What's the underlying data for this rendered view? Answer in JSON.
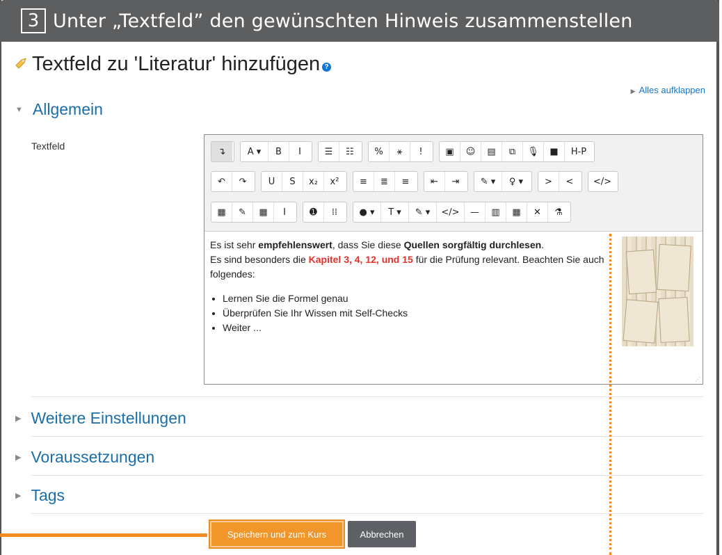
{
  "banner": {
    "step": "3",
    "text": "Unter „Textfeld” den gewünschten Hinweis zusammenstellen"
  },
  "page_title": "Textfeld zu 'Literatur' hinzufügen",
  "expand_all": "Alles aufklappen",
  "sections": {
    "general": "Allgemein",
    "more_settings": "Weitere Einstellungen",
    "restrictions": "Voraussetzungen",
    "tags": "Tags"
  },
  "field_label": "Textfeld",
  "toolbar": {
    "row1": [
      [
        "↴"
      ],
      [
        "A ▾",
        "B",
        "I"
      ],
      [
        "☰",
        "☷"
      ],
      [
        "%",
        "⚹",
        "!"
      ],
      [
        "▣",
        "☺",
        "▤",
        "⧉",
        "🎙",
        "■",
        "H-P"
      ]
    ],
    "row2": [
      [
        "↶",
        "↷"
      ],
      [
        "U",
        "S",
        "x₂",
        "x²"
      ],
      [
        "≡",
        "≣",
        "≡"
      ],
      [
        "⇤",
        "⇥"
      ],
      [
        "✎ ▾",
        "♀ ▾"
      ],
      [
        ">",
        "<"
      ],
      [
        "</>"
      ]
    ],
    "row3": [
      [
        "▦",
        "✎",
        "▦",
        "I"
      ],
      [
        "➊",
        "⁞⁞"
      ],
      [
        "● ▾",
        "T ▾",
        "✎ ▾",
        "</>",
        "—",
        "▥",
        "▦",
        "✕",
        "⚗"
      ]
    ]
  },
  "content": {
    "line1_a": "Es ist sehr ",
    "line1_b": "empfehlenswert",
    "line1_c": ", dass Sie diese ",
    "line1_d": "Quellen sorgfältig durchlesen",
    "line1_e": ".",
    "line2_a": "Es sind besonders die ",
    "line2_b": "Kapitel 3, 4, 12, und 15",
    "line2_c": " für die Prüfung relevant. Beachten Sie auch folgendes:",
    "bullets": [
      "Lernen Sie die Formel genau",
      "Überprüfen Sie Ihr Wissen mit Self-Checks",
      "Weiter ..."
    ]
  },
  "buttons": {
    "save": "Speichern und zum Kurs",
    "cancel": "Abbrechen"
  },
  "colors": {
    "accent": "#ef8b21",
    "link": "#1177d1",
    "banner": "#5c5e60"
  }
}
